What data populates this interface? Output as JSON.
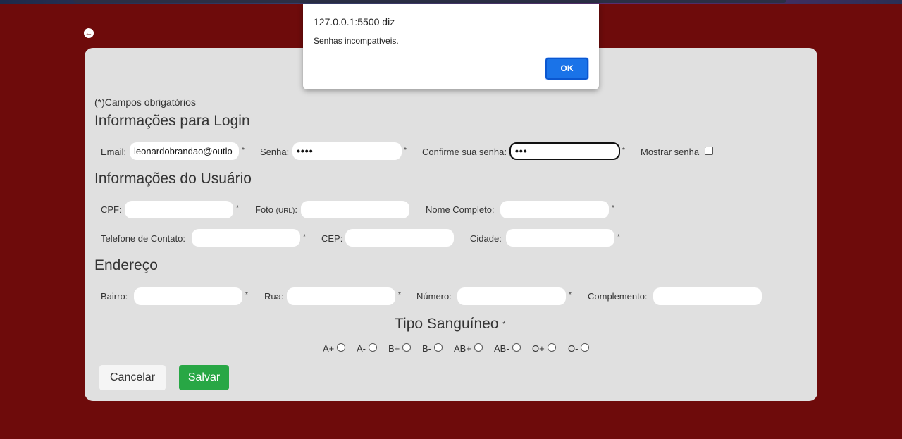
{
  "form": {
    "required_note": "(*)Campos obrigatórios",
    "required_mark": "*",
    "login": {
      "title": "Informações para Login",
      "email_label": "Email:",
      "email_value": "leonardobrandao@outlo",
      "password_label": "Senha:",
      "password_value": "••••",
      "confirm_label": "Confirme sua senha:",
      "confirm_value": "•••",
      "show_password_label": "Mostrar senha"
    },
    "user": {
      "title": "Informações do Usuário",
      "cpf_label": "CPF:",
      "photo_label": "Foto",
      "photo_small": "(URL)",
      "photo_colon": ":",
      "fullname_label": "Nome Completo:",
      "phone_label": "Telefone de Contato:",
      "cep_label": "CEP:",
      "city_label": "Cidade:"
    },
    "address": {
      "title": "Endereço",
      "district_label": "Bairro:",
      "street_label": "Rua:",
      "number_label": "Número:",
      "complement_label": "Complemento:"
    },
    "blood": {
      "title": "Tipo Sanguíneo",
      "options": [
        "A+",
        "A-",
        "B+",
        "B-",
        "AB+",
        "AB-",
        "O+",
        "O-"
      ]
    },
    "buttons": {
      "cancel": "Cancelar",
      "save": "Salvar"
    }
  },
  "back_icon": "arrow-left-circle-icon",
  "dialog": {
    "title": "127.0.0.1:5500 diz",
    "message": "Senhas incompatíveis.",
    "ok": "OK"
  },
  "colors": {
    "page_background": "#6e0b0b",
    "card_background": "#e0e0e0",
    "save_button": "#28a745",
    "dialog_ok": "#1a73e8"
  }
}
